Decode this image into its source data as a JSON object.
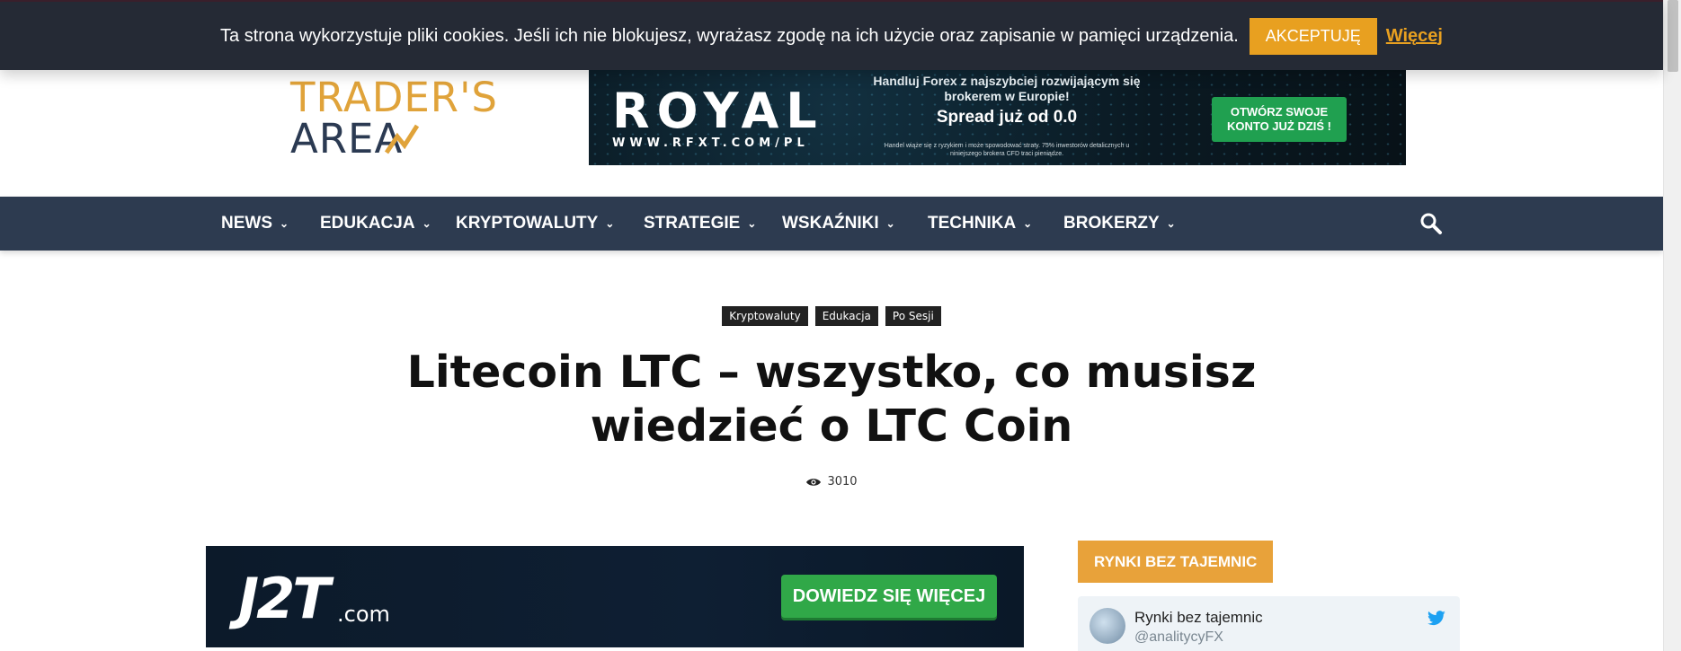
{
  "cookie": {
    "text": "Ta strona wykorzystuje pliki cookies. Jeśli ich nie blokujesz, wyrażasz zgodę na ich użycie oraz zapisanie w pamięci urządzenia.",
    "accept_label": "AKCEPTUJĘ",
    "more_label": "Więcej"
  },
  "logo": {
    "line1": "TRADER'S",
    "line2": "AREA"
  },
  "banner": {
    "brand": "ROYAL",
    "url": "WWW.RFXT.COM/PL",
    "headline": "Handluj Forex z najszybciej rozwijającym się brokerem w Europie!",
    "spread": "Spread już od 0.0",
    "disclaimer": "Handel wiąże się z ryzykiem i może spowodować straty. 75% inwestorów detalicznych u niniejszego brokera CFD traci pieniądze.",
    "cta": "OTWÓRZ SWOJE KONTO JUŻ DZIŚ !"
  },
  "nav": {
    "items": [
      {
        "label": "NEWS"
      },
      {
        "label": "EDUKACJA"
      },
      {
        "label": "KRYPTOWALUTY"
      },
      {
        "label": "STRATEGIE"
      },
      {
        "label": "WSKAŹNIKI"
      },
      {
        "label": "TECHNIKA"
      },
      {
        "label": "BROKERZY"
      }
    ],
    "search_icon": "search-icon"
  },
  "article": {
    "tags": [
      "Kryptowaluty",
      "Edukacja",
      "Po Sesji"
    ],
    "title": "Litecoin LTC – wszystko, co musisz wiedzieć o LTC Coin",
    "views": "3010"
  },
  "ad": {
    "logo": "J2T",
    "domain": ".com",
    "cta": "DOWIEDZ SIĘ WIĘCEJ"
  },
  "sidebar": {
    "heading": "RYNKI BEZ TAJEMNIC",
    "twitter": {
      "name": "Rynki bez tajemnic",
      "handle": "@analitycyFX"
    }
  },
  "colors": {
    "nav_bg": "#2d3b50",
    "accent": "#e8a23a",
    "cookie_bg": "#252a35",
    "cta_green": "#30a848",
    "twitter_blue": "#1da1f2"
  }
}
